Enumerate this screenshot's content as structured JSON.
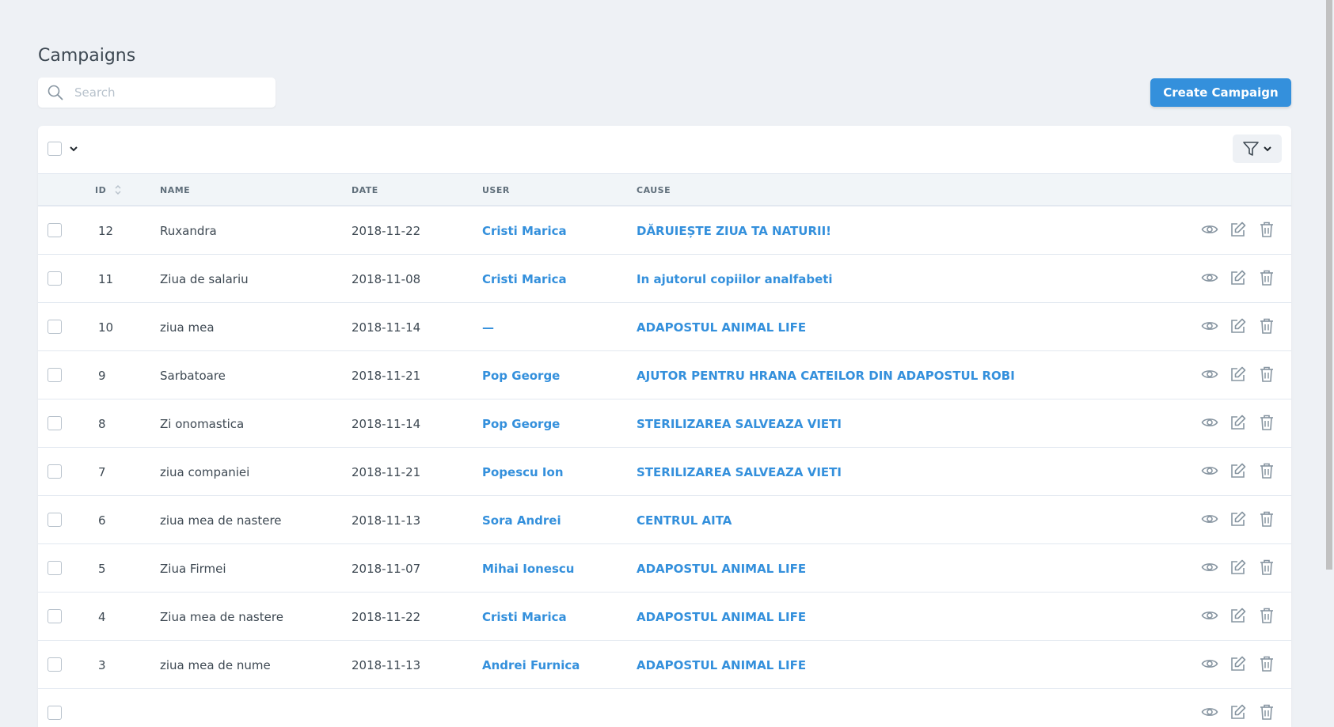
{
  "page": {
    "title": "Campaigns"
  },
  "search": {
    "placeholder": "Search"
  },
  "header_actions": {
    "create_label": "Create Campaign"
  },
  "colors": {
    "accent": "#3490dc",
    "background": "#eef1f5",
    "text": "#3d4852"
  },
  "table": {
    "columns": {
      "id": "ID",
      "name": "NAME",
      "date": "DATE",
      "user": "USER",
      "cause": "CAUSE"
    },
    "rows": [
      {
        "id": "12",
        "name": "Ruxandra",
        "date": "2018-11-22",
        "user": "Cristi Marica",
        "cause": "DĂRUIEȘTE ZIUA TA NATURII!"
      },
      {
        "id": "11",
        "name": "Ziua de salariu",
        "date": "2018-11-08",
        "user": "Cristi Marica",
        "cause": "In ajutorul copiilor analfabeti"
      },
      {
        "id": "10",
        "name": "ziua mea",
        "date": "2018-11-14",
        "user": "—",
        "cause": "ADAPOSTUL ANIMAL LIFE"
      },
      {
        "id": "9",
        "name": "Sarbatoare",
        "date": "2018-11-21",
        "user": "Pop George",
        "cause": "AJUTOR PENTRU HRANA CATEILOR DIN ADAPOSTUL ROBI"
      },
      {
        "id": "8",
        "name": "Zi onomastica",
        "date": "2018-11-14",
        "user": "Pop George",
        "cause": "STERILIZAREA SALVEAZA VIETI"
      },
      {
        "id": "7",
        "name": "ziua companiei",
        "date": "2018-11-21",
        "user": "Popescu Ion",
        "cause": "STERILIZAREA SALVEAZA VIETI"
      },
      {
        "id": "6",
        "name": "ziua mea de nastere",
        "date": "2018-11-13",
        "user": "Sora Andrei",
        "cause": "CENTRUL AITA"
      },
      {
        "id": "5",
        "name": "Ziua Firmei",
        "date": "2018-11-07",
        "user": "Mihai Ionescu",
        "cause": "ADAPOSTUL ANIMAL LIFE"
      },
      {
        "id": "4",
        "name": "Ziua mea de nastere",
        "date": "2018-11-22",
        "user": "Cristi Marica",
        "cause": "ADAPOSTUL ANIMAL LIFE"
      },
      {
        "id": "3",
        "name": "ziua mea de nume",
        "date": "2018-11-13",
        "user": "Andrei Furnica",
        "cause": "ADAPOSTUL ANIMAL LIFE"
      }
    ],
    "row_actions": [
      "eye-icon",
      "edit-icon",
      "trash-icon"
    ]
  }
}
